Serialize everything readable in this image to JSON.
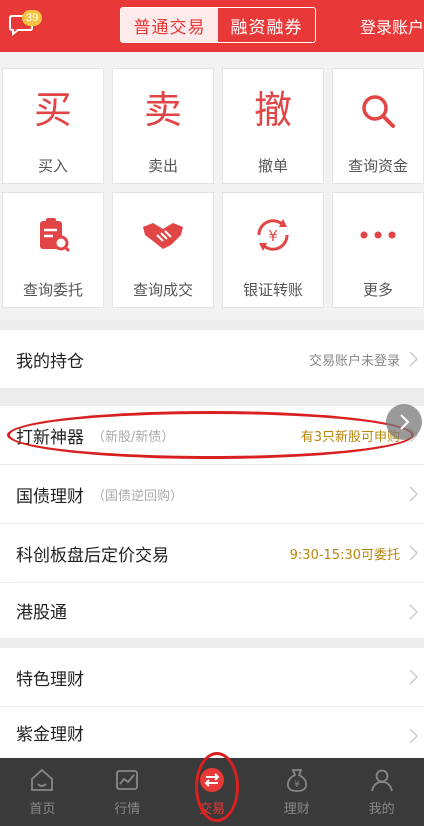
{
  "header": {
    "badge_count": "39",
    "tab_normal": "普通交易",
    "tab_margin": "融资融券",
    "login": "登录账户"
  },
  "grid": [
    {
      "label": "买入",
      "glyph": "买",
      "icon": "buy-icon"
    },
    {
      "label": "卖出",
      "glyph": "卖",
      "icon": "sell-icon"
    },
    {
      "label": "撤单",
      "glyph": "撤",
      "icon": "cancel-icon"
    },
    {
      "label": "查询资金",
      "icon": "search-icon"
    },
    {
      "label": "查询委托",
      "icon": "clipboard-search-icon"
    },
    {
      "label": "查询成交",
      "icon": "handshake-icon"
    },
    {
      "label": "银证转账",
      "icon": "yen-transfer-icon"
    },
    {
      "label": "更多",
      "icon": "more-dots-icon"
    }
  ],
  "list": {
    "holdings": {
      "title": "我的持仓",
      "right": "交易账户未登录"
    },
    "ipo": {
      "title": "打新神器",
      "sub": "（新股/新债）",
      "right": "有3只新股可申购"
    },
    "bond": {
      "title": "国债理财",
      "sub": "（国债逆回购）"
    },
    "star": {
      "title": "科创板盘后定价交易",
      "right": "9:30-15:30可委托"
    },
    "hk": {
      "title": "港股通"
    },
    "special": {
      "title": "特色理财"
    },
    "zijin": {
      "title": "紫金理财"
    }
  },
  "nav": [
    {
      "label": "首页",
      "icon": "home-icon"
    },
    {
      "label": "行情",
      "icon": "market-chart-icon"
    },
    {
      "label": "交易",
      "icon": "trade-exchange-icon"
    },
    {
      "label": "理财",
      "icon": "wealth-bag-icon"
    },
    {
      "label": "我的",
      "icon": "user-icon"
    }
  ],
  "colors": {
    "brand_red": "#e83838",
    "gold": "#b8860b",
    "nav_bg": "#3a3a3a"
  }
}
